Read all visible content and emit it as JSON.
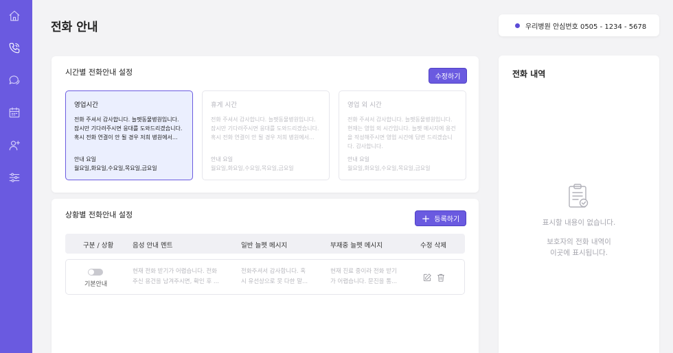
{
  "page": {
    "title": "전화 안내"
  },
  "sidebar": {
    "items": [
      {
        "name": "home",
        "icon": "home-icon",
        "active": false
      },
      {
        "name": "phone",
        "icon": "phone-icon",
        "active": true
      },
      {
        "name": "chat",
        "icon": "chat-icon",
        "active": false
      },
      {
        "name": "calendar",
        "icon": "calendar-icon",
        "active": false
      },
      {
        "name": "user-add",
        "icon": "user-add-icon",
        "active": false
      },
      {
        "name": "settings",
        "icon": "sliders-icon",
        "active": false
      }
    ],
    "colors": {
      "background": "#6a5ae0"
    }
  },
  "phone_info": {
    "text": "우리병원 안심번호 0505 - 1234 - 5678"
  },
  "time_settings": {
    "title": "시간별 전화안내 설정",
    "edit_label": "수정하기",
    "cards": [
      {
        "title": "영업시간",
        "body": "전화 주셔서 감사합니다. 늘펫동물병원입니다.\n잠시만 기다려주시면 응대를 도와드리겠습니다.\n혹시 전화 연결이 안 될 경우 저희 병원에서...",
        "days_label": "안내 요일",
        "days": "월요일,화요일,수요일,목요일,금요일"
      },
      {
        "title": "휴게 시간",
        "body": "전화 주셔서 감사합니다. 늘펫동물병원입니다.\n잠시만 기다려주시면 응대를 도와드리겠습니다.\n혹시 전화 연결이 안 될 경우 저희 병원에서...",
        "days_label": "안내 요일",
        "days": "월요일,화요일,수요일,목요일,금요일"
      },
      {
        "title": "영업 외 시간",
        "body": "전화 주셔서 감사합니다. 늘펫동물병원입니다.\n현재는 영업 외 시간입니다. 늘펫 메시지에 용건\n을 작성해주시면 영업 시간에 답변 드리겠습니\n다. 감사합니다.",
        "days_label": "안내 요일",
        "days": "월요일,화요일,수요일,목요일,금요일"
      }
    ]
  },
  "situation_settings": {
    "title": "상황별 전화안내 설정",
    "register_label": "등록하기",
    "columns": [
      "구분 / 상황",
      "음성 안내 멘트",
      "일반 늘펫 메시지",
      "부재중 늘펫 메시지",
      "수정 삭제"
    ],
    "rows": [
      {
        "type": "기본안내",
        "toggle_on": false,
        "voice": "현재 전화 받기가 어렵습니다. 전화\n주신 용건을 남겨주시면, 확인 후 ...",
        "general": "전화주셔서 감사합니다. 혹\n시 유선상으로 못 다한 말...",
        "missed": "현재 진료 중이라 전화 받기\n가 어렵습니다. 문진을 통..."
      }
    ]
  },
  "history": {
    "title": "전화 내역",
    "empty_line1": "표시할 내용이 없습니다.",
    "empty_line2": "보호자의 전화 내역이",
    "empty_line3": "이곳에 표시됩니다."
  },
  "colors": {
    "accent": "#6a5ae0",
    "active_card_bg": "#ebeffe",
    "page_bg": "#f3f3f5"
  }
}
